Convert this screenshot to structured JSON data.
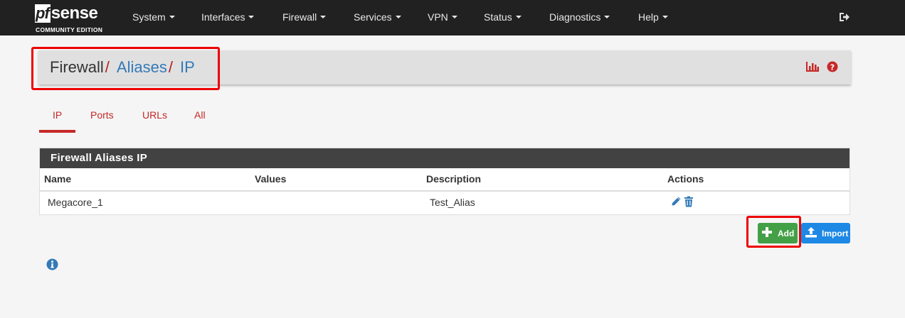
{
  "brand": {
    "logo_pf": "pf",
    "logo_sense": "sense",
    "edition": "COMMUNITY EDITION"
  },
  "nav": {
    "items": [
      {
        "label": "System"
      },
      {
        "label": "Interfaces"
      },
      {
        "label": "Firewall"
      },
      {
        "label": "Services"
      },
      {
        "label": "VPN"
      },
      {
        "label": "Status"
      },
      {
        "label": "Diagnostics"
      },
      {
        "label": "Help"
      }
    ],
    "logout_icon": "sign-out-icon"
  },
  "breadcrumb": {
    "root": "Firewall",
    "separator": "/",
    "level1": "Aliases",
    "level2": "IP",
    "icons": [
      "bar-chart-icon",
      "help-circle-icon"
    ]
  },
  "tabs": [
    {
      "label": "IP",
      "active": true
    },
    {
      "label": "Ports",
      "active": false
    },
    {
      "label": "URLs",
      "active": false
    },
    {
      "label": "All",
      "active": false
    }
  ],
  "table": {
    "title": "Firewall Aliases IP",
    "columns": [
      "Name",
      "Values",
      "Description",
      "Actions"
    ],
    "rows": [
      {
        "name": "Megacore_1",
        "values": "",
        "description": "Test_Alias",
        "actions": [
          "pencil-icon",
          "trash-icon"
        ]
      }
    ]
  },
  "buttons": {
    "add_label": "Add",
    "import_label": "Import"
  },
  "footer": {
    "info_icon": "info-circle-icon"
  },
  "colors": {
    "navbar": "#212121",
    "accent_red": "#c62828",
    "link_blue": "#337ab7",
    "panel_heading": "#424242",
    "add_green": "#43a047",
    "import_blue": "#1e88e5",
    "highlight_box": "#ee0000"
  }
}
